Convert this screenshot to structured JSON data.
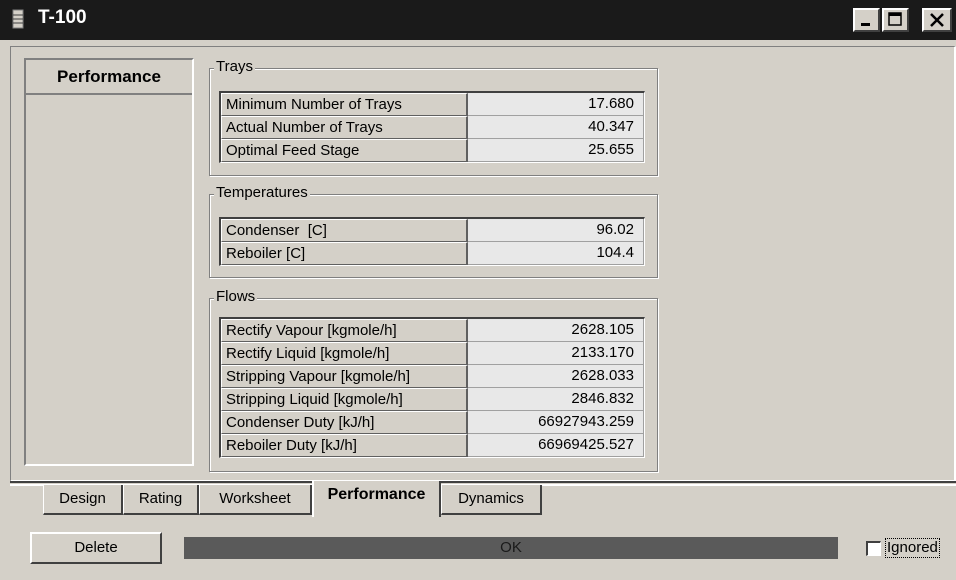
{
  "window": {
    "title": "T-100",
    "buttons": {
      "minimize": "_",
      "maximize": "□",
      "close": "X"
    }
  },
  "sidebar": {
    "heading": "Performance"
  },
  "groups": {
    "trays": {
      "label": "Trays",
      "rows": [
        {
          "label": "Minimum Number of Trays",
          "value": "17.680"
        },
        {
          "label": "Actual Number of Trays",
          "value": "40.347"
        },
        {
          "label": "Optimal Feed Stage",
          "value": "25.655"
        }
      ]
    },
    "temperatures": {
      "label": "Temperatures",
      "rows": [
        {
          "label": "Condenser  [C]",
          "value": "96.02"
        },
        {
          "label": "Reboiler [C]",
          "value": "104.4"
        }
      ]
    },
    "flows": {
      "label": "Flows",
      "rows": [
        {
          "label": "Rectify Vapour [kgmole/h]",
          "value": "2628.105"
        },
        {
          "label": "Rectify Liquid [kgmole/h]",
          "value": "2133.170"
        },
        {
          "label": "Stripping Vapour [kgmole/h]",
          "value": "2628.033"
        },
        {
          "label": "Stripping Liquid [kgmole/h]",
          "value": "2846.832"
        },
        {
          "label": "Condenser Duty [kJ/h]",
          "value": "66927943.259"
        },
        {
          "label": "Reboiler Duty [kJ/h]",
          "value": "66969425.527"
        }
      ]
    }
  },
  "tabs": [
    {
      "label": "Design",
      "active": false
    },
    {
      "label": "Rating",
      "active": false
    },
    {
      "label": "Worksheet",
      "active": false
    },
    {
      "label": "Performance",
      "active": true
    },
    {
      "label": "Dynamics",
      "active": false
    }
  ],
  "footer": {
    "delete_label": "Delete",
    "status_text": "OK",
    "ignored_label": "Ignored",
    "ignored_checked": false
  }
}
